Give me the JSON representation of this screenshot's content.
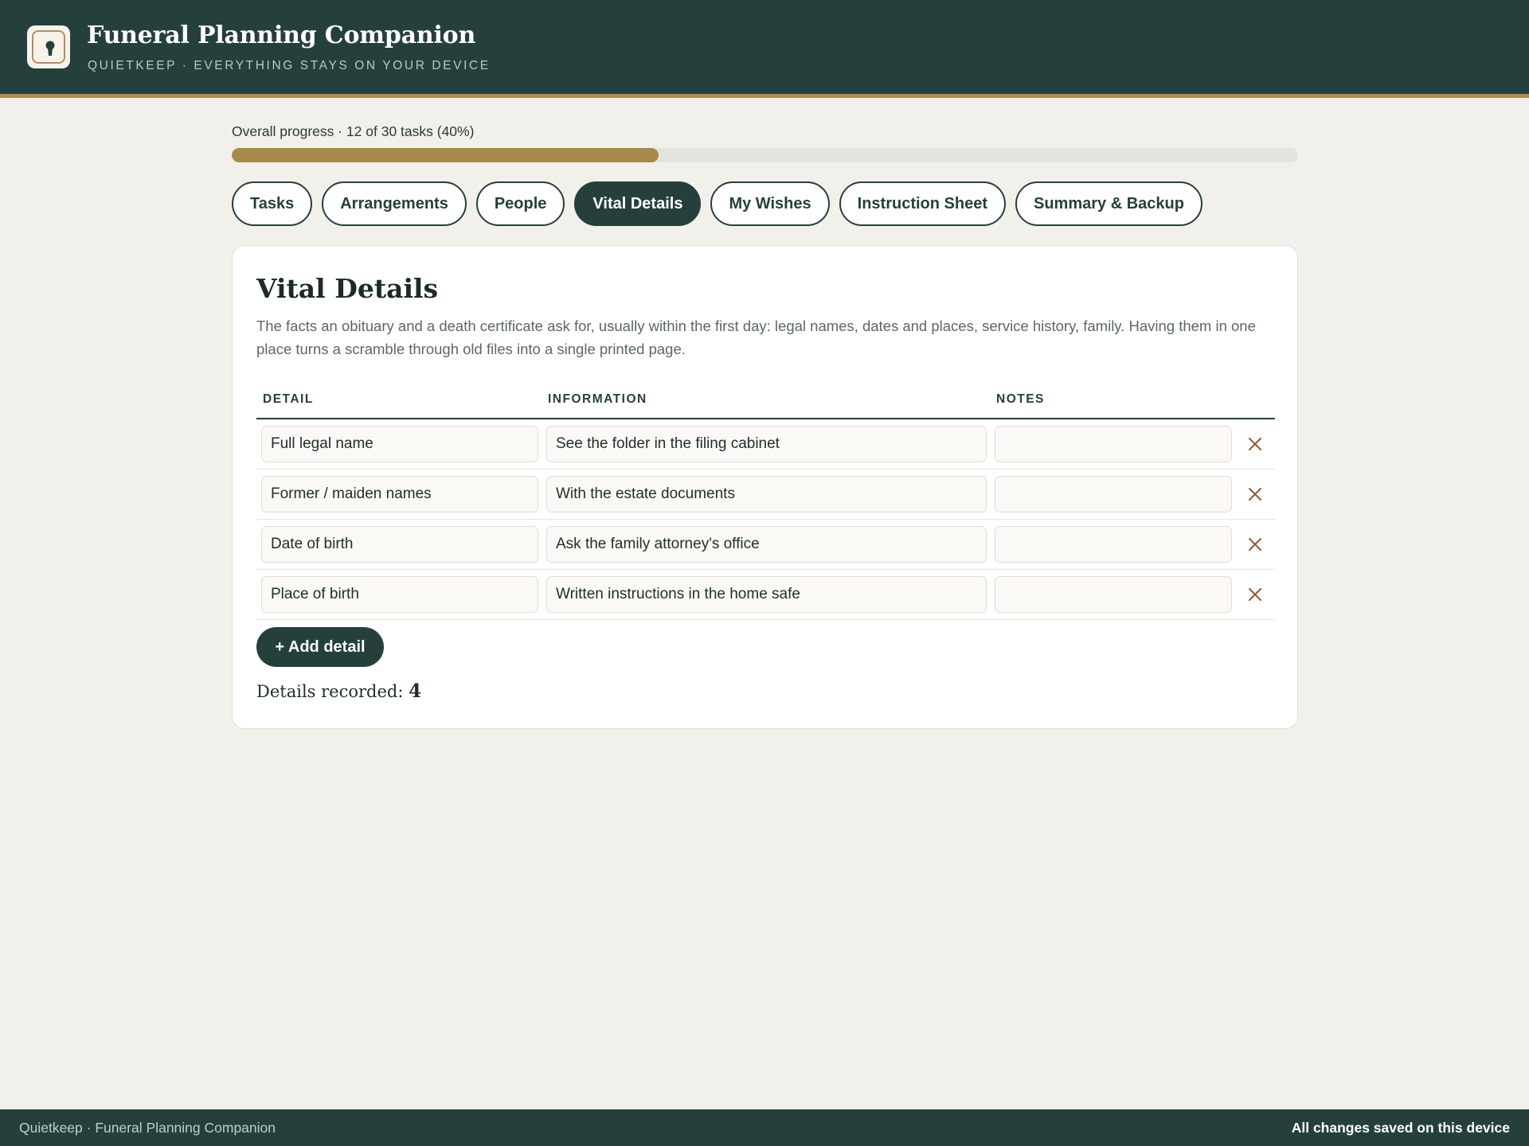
{
  "header": {
    "title": "Funeral Planning Companion",
    "subtitle": "QUIETKEEP · EVERYTHING STAYS ON YOUR DEVICE",
    "logo_icon": "keyhole-icon"
  },
  "progress": {
    "label": "Overall progress · 12 of 30 tasks (40%)",
    "completed": 12,
    "total": 30,
    "percent": 40
  },
  "tabs": [
    {
      "label": "Tasks",
      "active": false
    },
    {
      "label": "Arrangements",
      "active": false
    },
    {
      "label": "People",
      "active": false
    },
    {
      "label": "Vital Details",
      "active": true
    },
    {
      "label": "My Wishes",
      "active": false
    },
    {
      "label": "Instruction Sheet",
      "active": false
    },
    {
      "label": "Summary & Backup",
      "active": false
    }
  ],
  "section": {
    "title": "Vital Details",
    "description": "The facts an obituary and a death certificate ask for, usually within the first day: legal names, dates and places, service history, family. Having them in one place turns a scramble through old files into a single printed page.",
    "columns": {
      "detail": "DETAIL",
      "information": "INFORMATION",
      "notes": "NOTES"
    },
    "rows": [
      {
        "detail": "Full legal name",
        "information": "See the folder in the filing cabinet",
        "notes": ""
      },
      {
        "detail": "Former / maiden names",
        "information": "With the estate documents",
        "notes": ""
      },
      {
        "detail": "Date of birth",
        "information": "Ask the family attorney's office",
        "notes": ""
      },
      {
        "detail": "Place of birth",
        "information": "Written instructions in the home safe",
        "notes": ""
      }
    ],
    "add_label": "+ Add detail",
    "count_label": "Details recorded:",
    "count_value": "4",
    "delete_icon": "close-icon"
  },
  "footer": {
    "left": "Quietkeep · Funeral Planning Companion",
    "right": "All changes saved on this device"
  },
  "colors": {
    "primary": "#25403c",
    "accent": "#a88a4e",
    "background": "#f2f0eb"
  }
}
